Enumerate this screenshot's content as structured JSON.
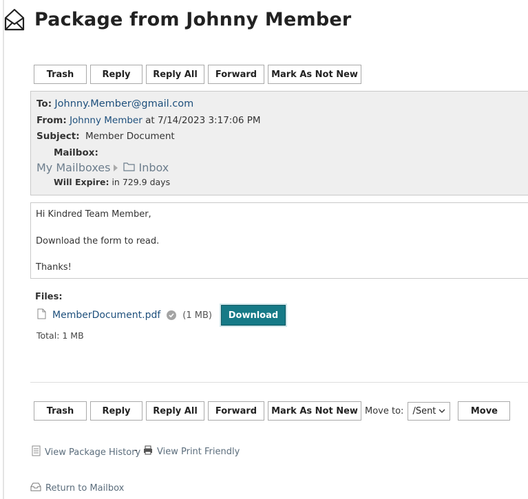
{
  "header": {
    "title": "Package from Johnny Member"
  },
  "toolbar_top": {
    "trash": "Trash",
    "reply": "Reply",
    "reply_all": "Reply All",
    "forward": "Forward",
    "mark_not_new": "Mark As Not New"
  },
  "message": {
    "to_label": "To:",
    "to_value": "Johnny.Member@gmail.com",
    "from_label": "From:",
    "from_value": "Johnny Member",
    "from_at": "at 7/14/2023 3:17:06 PM",
    "subject_label": "Subject:",
    "subject_value": "Member Document",
    "mailbox_label": "Mailbox:",
    "mailbox_path": [
      "My Mailboxes",
      "Inbox"
    ],
    "expire_label": "Will Expire:",
    "expire_value": "in 729.9 days"
  },
  "body": {
    "lines": [
      "Hi Kindred Team Member,",
      "Download the form to read.",
      "Thanks!"
    ]
  },
  "files": {
    "label": "Files:",
    "items": [
      {
        "name": "MemberDocument.pdf",
        "size": "(1 MB)",
        "download": "Download"
      }
    ],
    "total": "Total: 1 MB"
  },
  "toolbar_bottom": {
    "trash": "Trash",
    "reply": "Reply",
    "reply_all": "Reply All",
    "forward": "Forward",
    "mark_not_new": "Mark As Not New",
    "move_to_label": "Move to:",
    "move_to_selected": "/Sent",
    "move": "Move"
  },
  "footer": {
    "history": "View Package History",
    "separator": "-",
    "print": "View Print Friendly",
    "return": "Return to Mailbox"
  },
  "colors": {
    "accent": "#167a87",
    "link": "#1d4f7c",
    "header_bg": "#efefef"
  },
  "icons": {
    "title": "open-envelope-icon",
    "file": "document-icon",
    "verified": "check-circle-icon",
    "folder": "folder-icon",
    "history": "history-icon",
    "print": "printer-icon",
    "return": "mailbox-icon"
  }
}
